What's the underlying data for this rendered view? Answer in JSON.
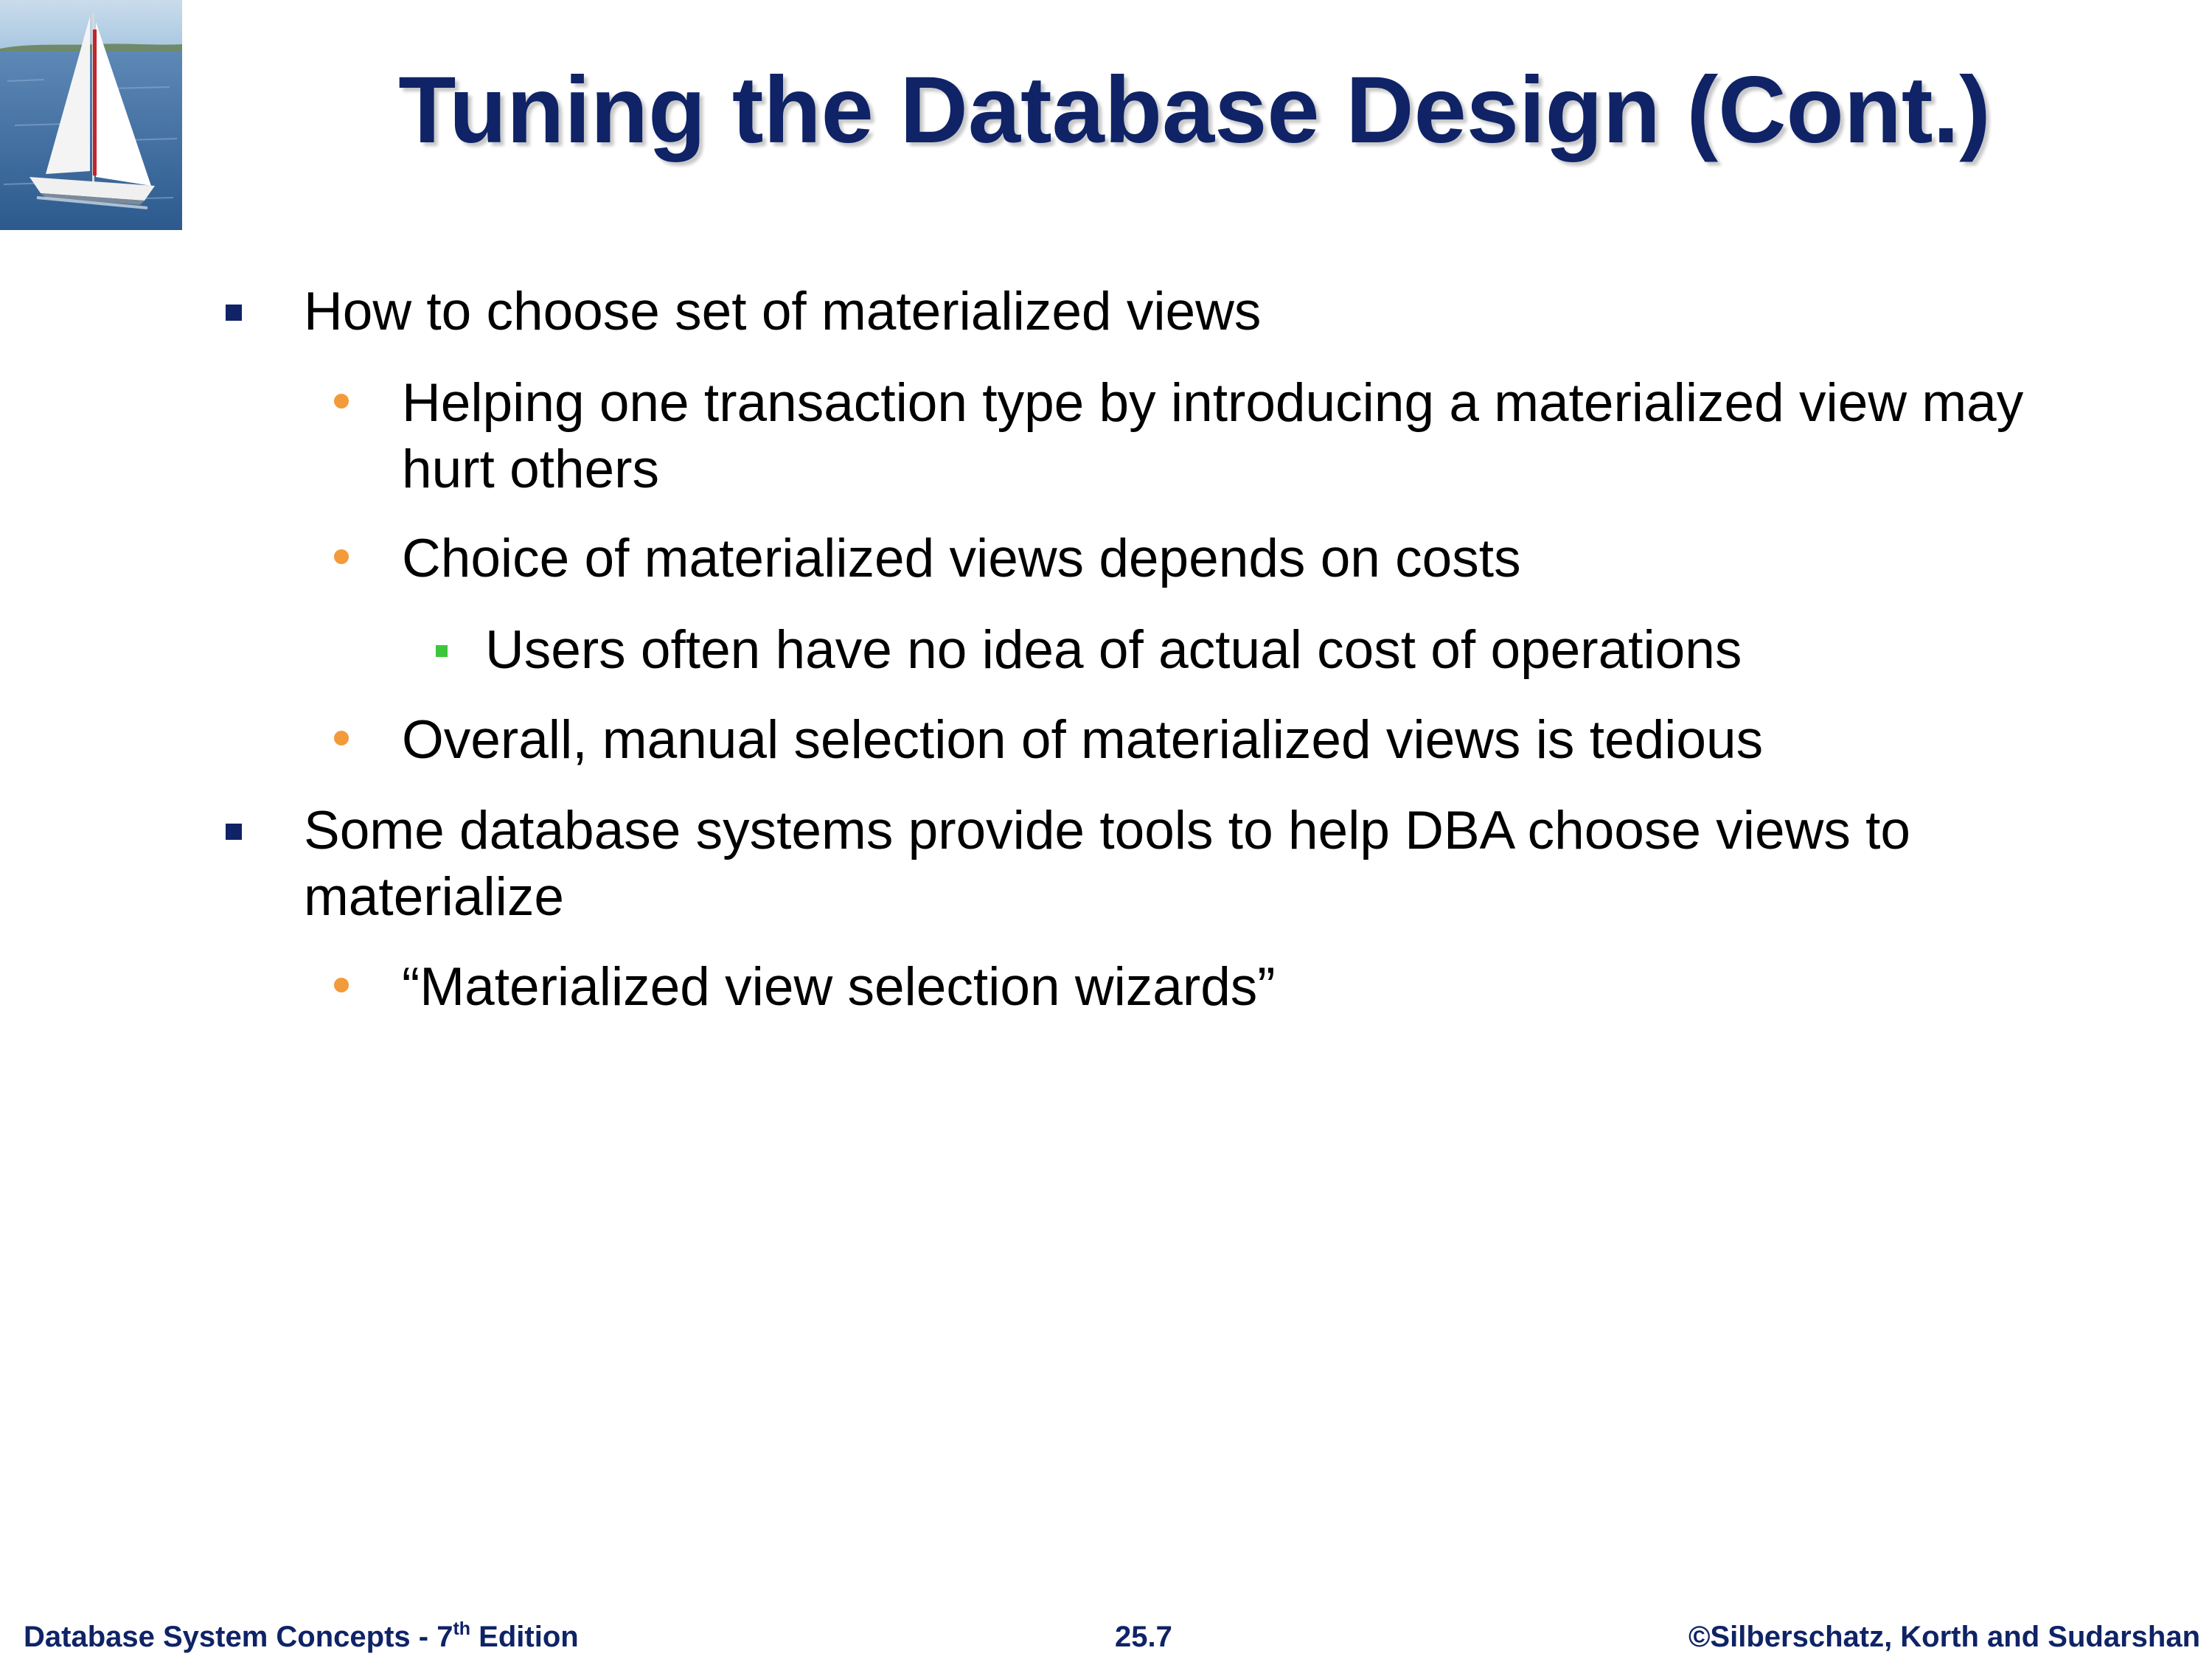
{
  "slide": {
    "title": "Tuning the Database Design (Cont.)",
    "logo_icon": "sailboat-icon",
    "colors": {
      "title": "#0f2366",
      "level1_bullet": "#0f2366",
      "level2_bullet": "#f39a3a",
      "level3_bullet": "#3cc63c",
      "footer": "#0f2366"
    },
    "bullets": [
      {
        "level": 1,
        "text": "How to choose set of materialized views"
      },
      {
        "level": 2,
        "text": "Helping one transaction type by introducing a materialized view may hurt others"
      },
      {
        "level": 2,
        "text": "Choice of materialized views depends on costs"
      },
      {
        "level": 3,
        "text": "Users often have no idea of actual cost of operations"
      },
      {
        "level": 2,
        "text": "Overall, manual selection of materialized views is tedious"
      },
      {
        "level": 1,
        "text": "Some database systems provide tools to help DBA choose views to materialize"
      },
      {
        "level": 2,
        "text": "“Materialized view selection wizards”"
      }
    ]
  },
  "footer": {
    "book_prefix": "Database System Concepts - 7",
    "book_sup": "th",
    "book_suffix": " Edition",
    "page_number": "25.7",
    "copyright": "©Silberschatz, Korth and Sudarshan"
  }
}
